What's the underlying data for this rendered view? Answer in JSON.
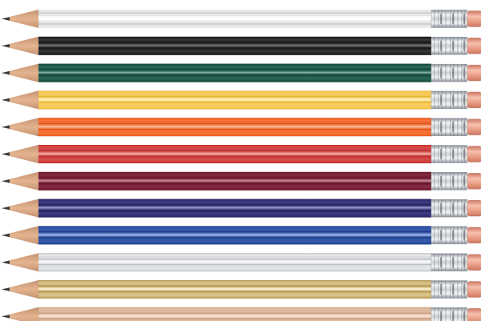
{
  "image": {
    "subject": "pencils-with-erasers"
  },
  "pencils": [
    {
      "name": "white",
      "barrel": "#f5f5f5",
      "stripe": "#d6d6d6",
      "highlight": "#ffffff"
    },
    {
      "name": "black",
      "barrel": "#161616",
      "stripe": "#3a3a3a",
      "highlight": "#555555"
    },
    {
      "name": "green",
      "barrel": "#12473c",
      "stripe": "#2f6d5d",
      "highlight": "#5a9686"
    },
    {
      "name": "yellow",
      "barrel": "#f2be3e",
      "stripe": "#ffd567",
      "highlight": "#fff0b5"
    },
    {
      "name": "orange",
      "barrel": "#ec5a1f",
      "stripe": "#ff7a3d",
      "highlight": "#ffb08a"
    },
    {
      "name": "red",
      "barrel": "#c4312f",
      "stripe": "#de5150",
      "highlight": "#f29a98"
    },
    {
      "name": "maroon",
      "barrel": "#6a1328",
      "stripe": "#8a2f46",
      "highlight": "#b76b80"
    },
    {
      "name": "navy",
      "barrel": "#24235f",
      "stripe": "#40418a",
      "highlight": "#7b7bc0"
    },
    {
      "name": "blue",
      "barrel": "#1f3f8f",
      "stripe": "#3d61b9",
      "highlight": "#88a7e8"
    },
    {
      "name": "silver",
      "barrel": "#c9ccd2",
      "stripe": "#eef0f3",
      "highlight": "#ffffff"
    },
    {
      "name": "gold",
      "barrel": "#b99b53",
      "stripe": "#e4d19a",
      "highlight": "#fff3cf"
    },
    {
      "name": "natural",
      "barrel": "#d7a889",
      "stripe": "#e8c4ad",
      "highlight": "#f7e2d3"
    }
  ],
  "wood": {
    "tip_wood": "#e4b48f",
    "tip_shadow": "#c49273",
    "lead": "#3b3b3b"
  },
  "ferrule": {
    "base": "#cfd3d8",
    "ridge": "#f6f7f9",
    "shadow": "#8d949c"
  },
  "eraser": {
    "base": "#e79980",
    "shade": "#cc7762",
    "highlight": "#f7c0ae"
  }
}
